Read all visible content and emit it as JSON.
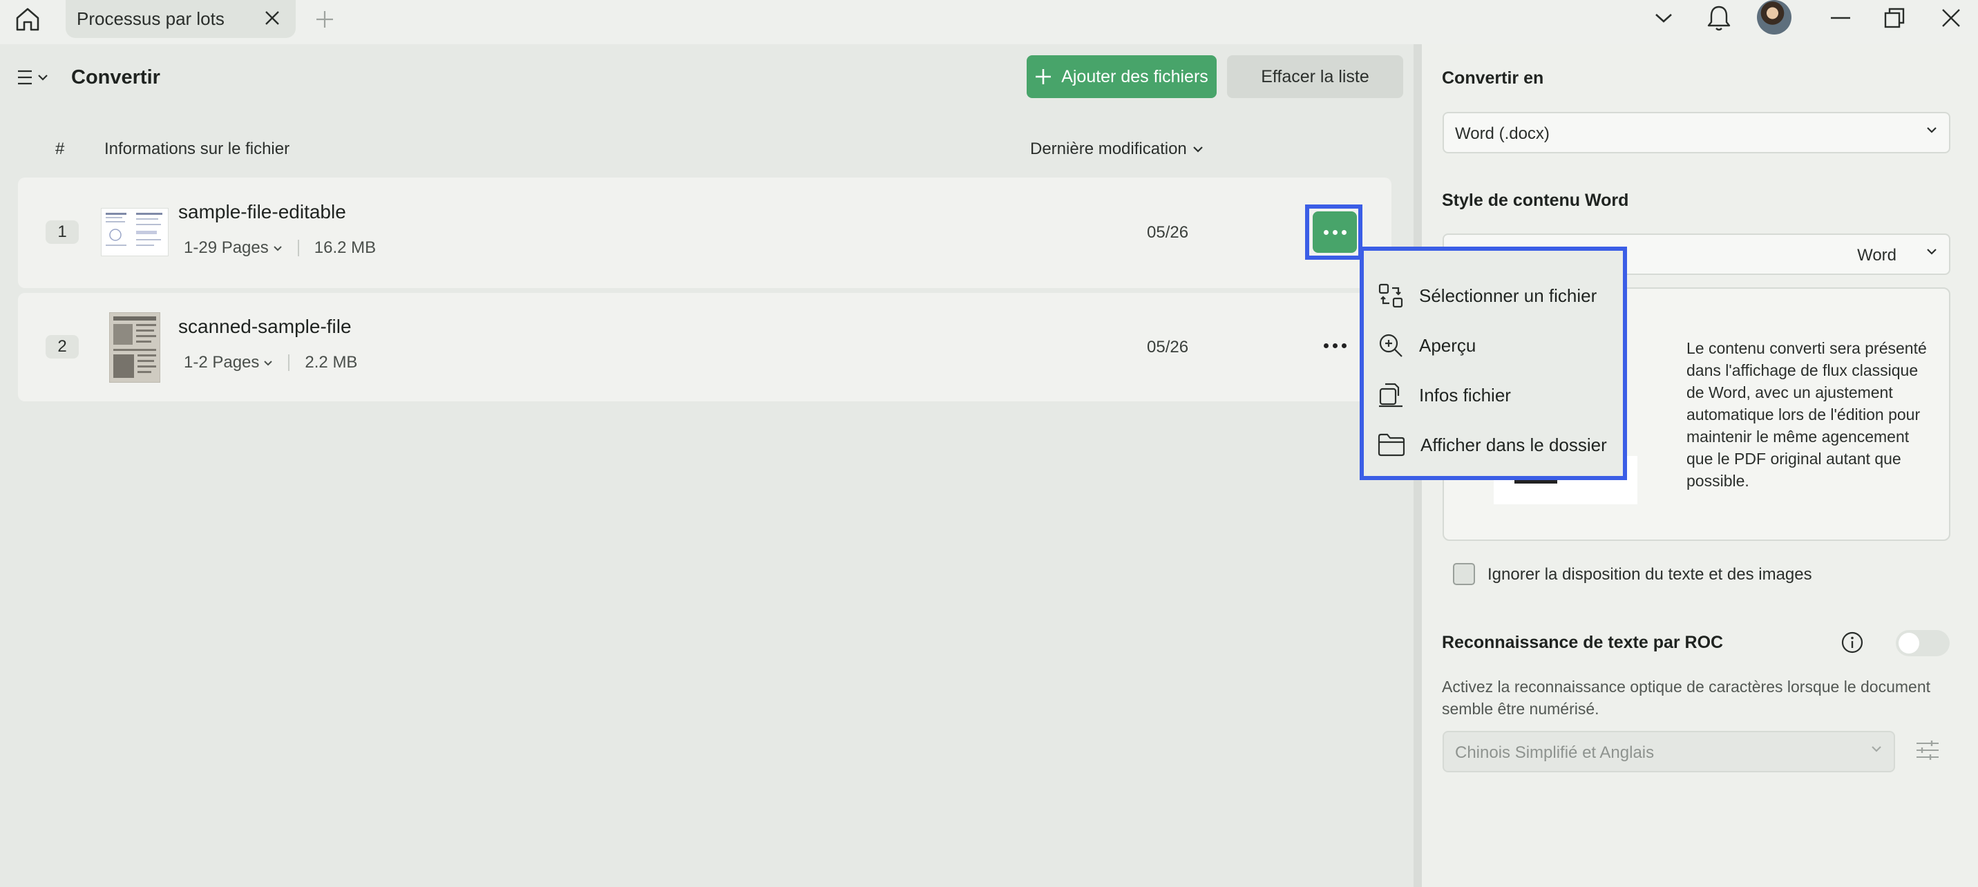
{
  "titlebar": {
    "tab_label": "Processus par lots"
  },
  "toolbar": {
    "title": "Convertir",
    "add_files_label": "Ajouter des fichiers",
    "clear_list_label": "Effacer la liste"
  },
  "table": {
    "columns": {
      "number": "#",
      "file_info": "Informations sur le fichier",
      "modified": "Dernière modification"
    },
    "rows": [
      {
        "num": "1",
        "name": "sample-file-editable",
        "pages": "1-29 Pages",
        "size": "16.2 MB",
        "date": "05/26"
      },
      {
        "num": "2",
        "name": "scanned-sample-file",
        "pages": "1-2 Pages",
        "size": "2.2 MB",
        "date": "05/26"
      }
    ]
  },
  "context_menu": {
    "items": [
      {
        "label": "Sélectionner un fichier",
        "icon": "select-file-icon"
      },
      {
        "label": "Aperçu",
        "icon": "zoom-in-icon"
      },
      {
        "label": "Infos fichier",
        "icon": "file-info-icon"
      },
      {
        "label": "Afficher dans le dossier",
        "icon": "folder-icon"
      }
    ]
  },
  "right_panel": {
    "convert_to_label": "Convertir en",
    "convert_to_value": "Word (.docx)",
    "style_label": "Style de contenu Word",
    "style_value": "Word",
    "style_description": "Le contenu converti sera présenté dans l'affichage de flux classique de Word, avec un ajustement automatique lors de l'édition pour maintenir le même agencement que le PDF original autant que possible.",
    "ignore_layout_label": "Ignorer la disposition du texte et des images",
    "ocr_title": "Reconnaissance de texte par ROC",
    "ocr_description": "Activez la reconnaissance optique de caractères lorsque le document semble être numérisé.",
    "ocr_language": "Chinois Simplifié et Anglais"
  },
  "colors": {
    "accent_green": "#48a46a",
    "highlight_blue": "#3b5ee6"
  }
}
